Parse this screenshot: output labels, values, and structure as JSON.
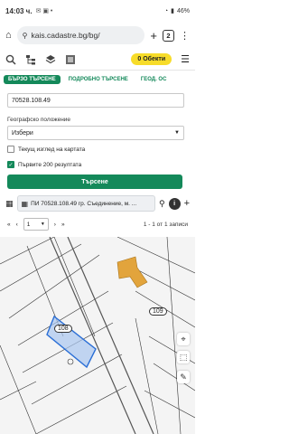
{
  "status": {
    "time": "14:03 ч.",
    "battery": "46%"
  },
  "browser": {
    "url": "kais.cadastre.bg/bg/",
    "tab_count": "2"
  },
  "toolbar": {
    "objects_label": "0 Обекти"
  },
  "tabs": [
    "БЪРЗО ТЪРСЕНЕ",
    "ПОДРОБНО ТЪРСЕНЕ",
    "ГЕОД. ОС"
  ],
  "search": {
    "query": "70528.108.49",
    "geo_label": "Географско положение",
    "geo_value": "Избери",
    "current_view_label": "Текущ изглед на картата",
    "first200_label": "Първите 200 резултата",
    "search_button": "Търсене"
  },
  "result": {
    "text": "ПИ 70528.108.49 гр. Съединение, м. ..."
  },
  "pager": {
    "page_size": "1",
    "count": "1 - 1 от 1 записи"
  },
  "map": {
    "label_108": "108",
    "label_109": "109"
  }
}
